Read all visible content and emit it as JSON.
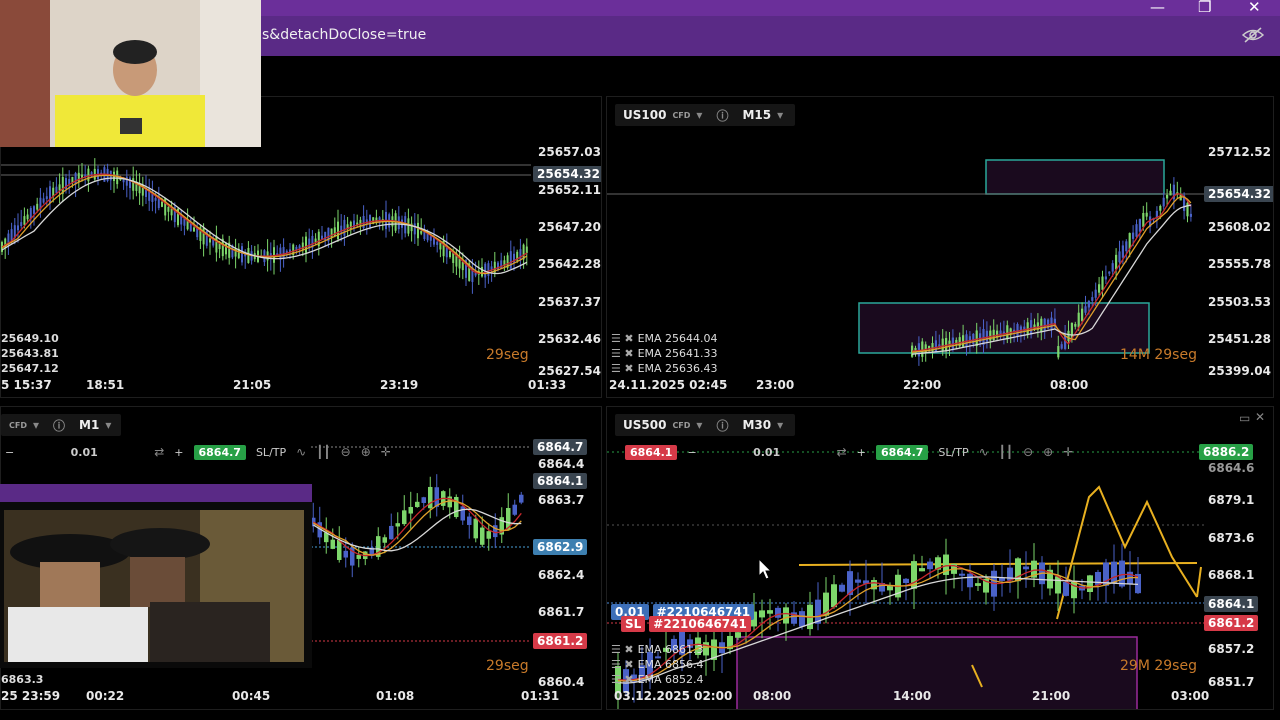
{
  "browser": {
    "url_fragment": "s&detachDoClose=true",
    "minimize": "—",
    "maximize": "❐",
    "close": "✕"
  },
  "panels": {
    "top_left": {
      "prices": [
        "25657.03",
        "25654.32",
        "25652.11",
        "25647.20",
        "25642.28",
        "25637.37",
        "25632.46",
        "25627.54"
      ],
      "current_tag": "25654.32",
      "times": [
        "5 15:37",
        "18:51",
        "21:05",
        "23:19",
        "01:33"
      ],
      "left_values": [
        "25649.10",
        "25643.81",
        "25647.12"
      ],
      "countdown": "29seg"
    },
    "top_right": {
      "symbol": "US100",
      "cfd": "CFD",
      "timeframe": "M15",
      "prices": [
        "25712.52",
        "25608.02",
        "25555.78",
        "25503.53",
        "25451.28",
        "25399.04"
      ],
      "current_tag": "25654.32",
      "times": [
        "24.11.2025 02:45",
        "23:00",
        "22:00",
        "08:00"
      ],
      "ema": [
        "EMA 25644.04",
        "EMA 25641.33",
        "EMA 25636.43"
      ],
      "countdown": "14M 29seg"
    },
    "bottom_left": {
      "cfd": "CFD",
      "timeframe": "M1",
      "lot": "0.01",
      "buy_price": "6864.7",
      "sltp": "SL/TP",
      "prices": [
        "6864.4",
        "6863.7",
        "6862.4",
        "6861.7",
        "6860.4"
      ],
      "tag_ask": "6864.7",
      "tag_bid": "6864.1",
      "tag_blue": "6862.9",
      "tag_red": "6861.2",
      "times": [
        "25 23:59",
        "00:22",
        "00:45",
        "01:08",
        "01:31"
      ],
      "left_value": "6863.3",
      "countdown": "29seg"
    },
    "bottom_right": {
      "symbol": "US500",
      "cfd": "CFD",
      "timeframe": "M30",
      "sell_price": "6864.1",
      "lot": "0.01",
      "buy_price": "6864.7",
      "sltp": "SL/TP",
      "prices": [
        "6864.6",
        "6879.1",
        "6873.6",
        "6868.1",
        "6857.2",
        "6851.7"
      ],
      "tag_top": "6886.2",
      "tag_bid": "6864.1",
      "tag_sl": "6861.2",
      "order_lot": "0.01",
      "order_id": "#2210646741",
      "sl_label": "SL",
      "sl_id": "#2210646741",
      "ema": [
        "EMA 6861.3",
        "EMA 6856.4",
        "EMA 6852.4"
      ],
      "times": [
        "03.12.2025 02:00",
        "08:00",
        "14:00",
        "21:00",
        "03:00"
      ],
      "countdown": "29M 29seg"
    }
  },
  "colors": {
    "purple": "#5a2a86",
    "bull": "#7dd66b",
    "bear": "#4a62c8",
    "ema1": "#c8282c",
    "ema2": "#e0a02a",
    "ema3": "#d8d8d8",
    "box": "#2aa89a"
  }
}
